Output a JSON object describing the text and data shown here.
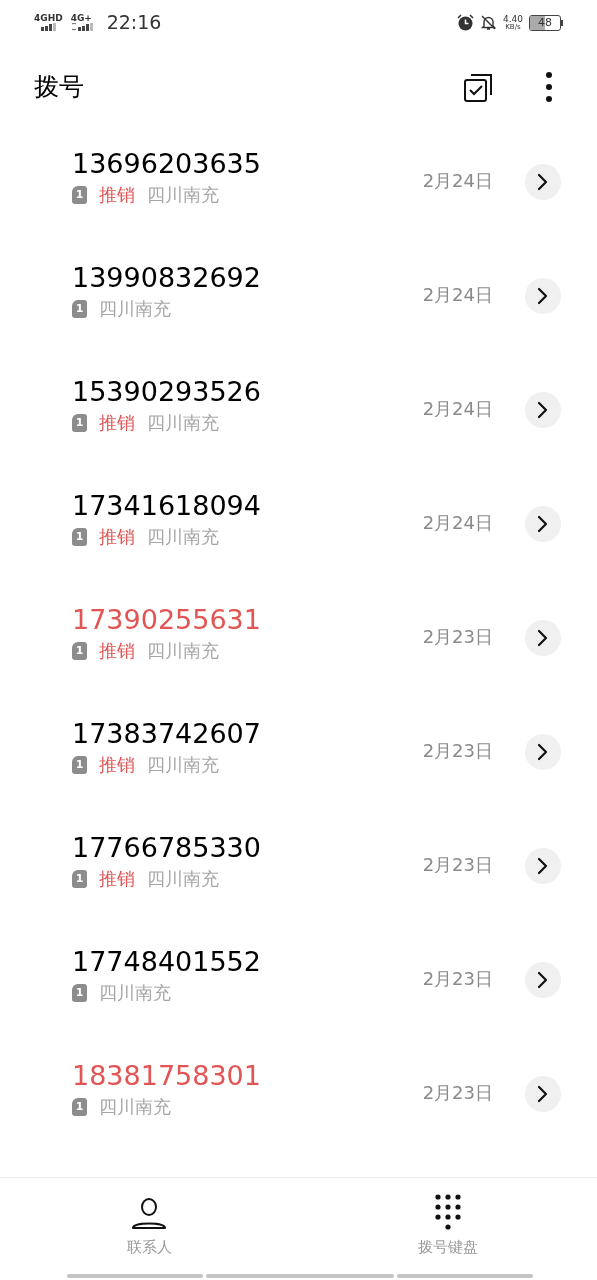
{
  "status_bar": {
    "network_1": "4GHD",
    "network_2": "4G+",
    "time": "22:16",
    "speed": "4.40",
    "speed_unit": "KB/s",
    "battery": "48"
  },
  "header": {
    "title": "拨号"
  },
  "calls": [
    {
      "number": "13696203635",
      "missed": false,
      "sim": "1",
      "tag": "推销",
      "location": "四川南充",
      "date": "2月24日"
    },
    {
      "number": "13990832692",
      "missed": false,
      "sim": "1",
      "location": "四川南充",
      "date": "2月24日"
    },
    {
      "number": "15390293526",
      "missed": false,
      "sim": "1",
      "tag": "推销",
      "location": "四川南充",
      "date": "2月24日"
    },
    {
      "number": "17341618094",
      "missed": false,
      "sim": "1",
      "tag": "推销",
      "location": "四川南充",
      "date": "2月24日"
    },
    {
      "number": "17390255631",
      "missed": true,
      "sim": "1",
      "tag": "推销",
      "location": "四川南充",
      "date": "2月23日"
    },
    {
      "number": "17383742607",
      "missed": false,
      "sim": "1",
      "tag": "推销",
      "location": "四川南充",
      "date": "2月23日"
    },
    {
      "number": "17766785330",
      "missed": false,
      "sim": "1",
      "tag": "推销",
      "location": "四川南充",
      "date": "2月23日"
    },
    {
      "number": "17748401552",
      "missed": false,
      "sim": "1",
      "location": "四川南充",
      "date": "2月23日"
    },
    {
      "number": "18381758301",
      "missed": true,
      "sim": "1",
      "location": "四川南充",
      "date": "2月23日"
    }
  ],
  "bottom_nav": [
    {
      "kind": "contacts",
      "label": "联系人"
    },
    {
      "kind": "dialpad",
      "label": "拨号键盘"
    }
  ]
}
